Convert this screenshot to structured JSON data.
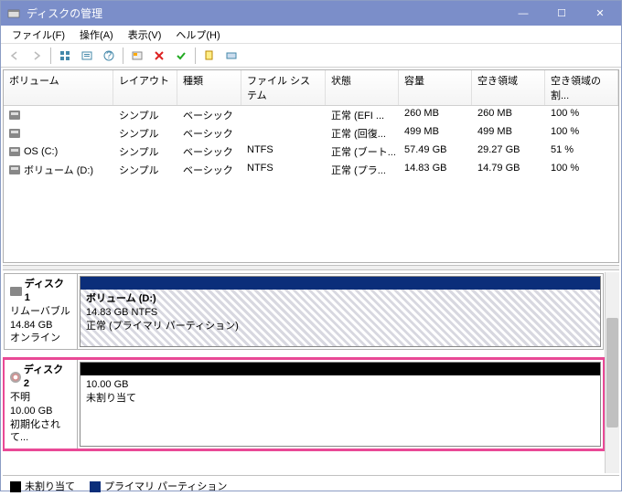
{
  "window": {
    "title": "ディスクの管理",
    "btn_min": "—",
    "btn_max": "☐",
    "btn_close": "✕"
  },
  "menu": {
    "file": "ファイル(F)",
    "action": "操作(A)",
    "view": "表示(V)",
    "help": "ヘルプ(H)"
  },
  "columns": {
    "volume": "ボリューム",
    "layout": "レイアウト",
    "type": "種類",
    "fs": "ファイル システム",
    "status": "状態",
    "capacity": "容量",
    "free": "空き領域",
    "freepct": "空き領域の割..."
  },
  "volumes": [
    {
      "name": "",
      "layout": "シンプル",
      "type": "ベーシック",
      "fs": "",
      "status": "正常 (EFI ...",
      "capacity": "260 MB",
      "free": "260 MB",
      "freepct": "100 %"
    },
    {
      "name": "",
      "layout": "シンプル",
      "type": "ベーシック",
      "fs": "",
      "status": "正常 (回復...",
      "capacity": "499 MB",
      "free": "499 MB",
      "freepct": "100 %"
    },
    {
      "name": "OS (C:)",
      "layout": "シンプル",
      "type": "ベーシック",
      "fs": "NTFS",
      "status": "正常 (ブート...",
      "capacity": "57.49 GB",
      "free": "29.27 GB",
      "freepct": "51 %"
    },
    {
      "name": "ボリューム (D:)",
      "layout": "シンプル",
      "type": "ベーシック",
      "fs": "NTFS",
      "status": "正常 (プラ...",
      "capacity": "14.83 GB",
      "free": "14.79 GB",
      "freepct": "100 %"
    }
  ],
  "disks": [
    {
      "name": "ディスク 1",
      "media": "リムーバブル",
      "size": "14.84 GB",
      "status": "オンライン",
      "icon": "drive",
      "highlight": false,
      "partition": {
        "type": "primary",
        "hatched": true,
        "title": "ボリューム  (D:)",
        "line2": "14.83 GB NTFS",
        "line3": "正常 (プライマリ パーティション)"
      }
    },
    {
      "name": "ディスク 2",
      "media": "不明",
      "size": "10.00 GB",
      "status": "初期化されて...",
      "icon": "cd",
      "highlight": true,
      "partition": {
        "type": "unalloc",
        "hatched": false,
        "title": "",
        "line2": "10.00 GB",
        "line3": "未割り当て"
      }
    }
  ],
  "legend": {
    "unalloc": "未割り当て",
    "primary": "プライマリ パーティション"
  }
}
